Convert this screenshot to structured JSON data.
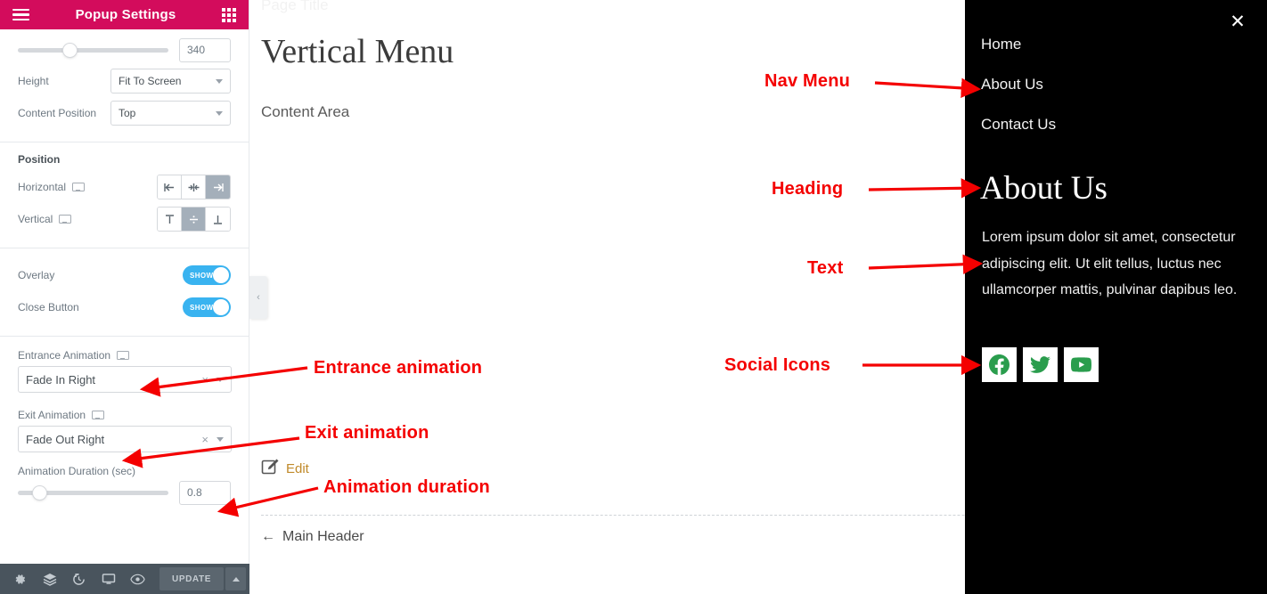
{
  "panel": {
    "header": {
      "title": "Popup Settings",
      "menu_icon": "hamburger-icon",
      "grid_icon": "grid-icon"
    },
    "width_value": "340",
    "fields": [
      {
        "label": "Height",
        "value": "Fit To Screen"
      },
      {
        "label": "Content Position",
        "value": "Top"
      }
    ],
    "position_section": {
      "title": "Position",
      "horizontal_label": "Horizontal",
      "vertical_label": "Vertical",
      "horizontal_selected": 2,
      "vertical_selected": 1
    },
    "toggles": [
      {
        "label": "Overlay",
        "state": "SHOW"
      },
      {
        "label": "Close Button",
        "state": "SHOW"
      }
    ],
    "animation": {
      "entrance_label": "Entrance Animation",
      "entrance_value": "Fade In Right",
      "exit_label": "Exit Animation",
      "exit_value": "Fade Out Right",
      "duration_label": "Animation Duration (sec)",
      "duration_value": "0.8",
      "clear_glyph": "×"
    },
    "footer": {
      "icons": [
        "gear-icon",
        "layers-icon",
        "history-icon",
        "responsive-icon",
        "preview-icon"
      ],
      "update_label": "UPDATE"
    }
  },
  "canvas": {
    "ghost_text": "Page Title",
    "page_title": "Vertical Menu",
    "content_area": "Content Area",
    "edit_label": "Edit",
    "main_header_label": "Main Header",
    "back_arrow": "←",
    "collapse_chevron": "‹"
  },
  "popup": {
    "close_glyph": "✕",
    "nav": [
      "Home",
      "About Us",
      "Contact Us"
    ],
    "heading": "About Us",
    "text": "Lorem ipsum dolor sit amet, consectetur adipiscing elit. Ut elit tellus, luctus nec ullamcorper mattis, pulvinar dapibus leo.",
    "social": [
      "facebook-icon",
      "twitter-icon",
      "youtube-icon"
    ]
  },
  "annotations": [
    {
      "label": "Entrance animation"
    },
    {
      "label": "Exit animation"
    },
    {
      "label": "Animation duration"
    },
    {
      "label": "Nav Menu"
    },
    {
      "label": "Heading"
    },
    {
      "label": "Text"
    },
    {
      "label": "Social Icons"
    }
  ],
  "colors": {
    "brand_pink": "#d30c5c",
    "toggle_blue": "#39b3f0",
    "annotation_red": "#f40000",
    "social_green": "#2a9d4d",
    "footer_dark": "#49545d",
    "edit_gold": "#c08a2b"
  }
}
